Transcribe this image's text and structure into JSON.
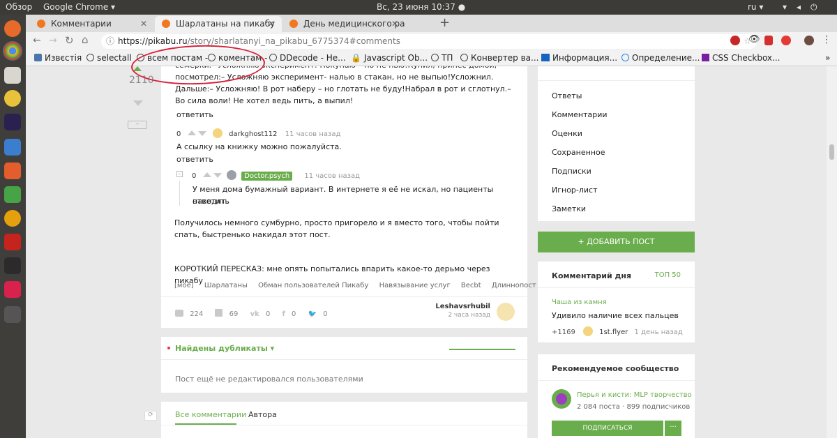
{
  "os": {
    "overview": "Обзор",
    "app": "Google Chrome ▾",
    "clock": "Вс, 23 июня  10:37 ●",
    "lang": "ru ▾"
  },
  "tabs": [
    {
      "label": "Комментарии"
    },
    {
      "label": "Шарлатаны на пикабу"
    },
    {
      "label": "День медицинского раб"
    }
  ],
  "address": {
    "prefix": "https://pikabu.ru",
    "path": "/story/sharlatanyi_na_pikabu_6775374#comments"
  },
  "bookmarks": [
    "Извєстія",
    "selectall",
    "всем постам -",
    "коментам -",
    "DDecode - He...",
    "Javascript Ob...",
    "ТП",
    "Конвертер ва...",
    "Информация...",
    "Определение...",
    "CSS Checkbox..."
  ],
  "post": {
    "rating": "2110",
    "top_text": "семерки.– Усложняю эксперимент! Покупаю – но не пью!Купил, принес домой, посмотрел:– Усложняю эксперимент- налью в стакан, но не выпью!Усложнил. Дальше:– Усложняю! В рот наберу – но глотать не буду!Набрал в рот и сглотнул.– Во сила воли! Не хотел ведь пить, а выпил!",
    "reply": "ответить",
    "comments": [
      {
        "score": "0",
        "user": "darkghost112",
        "time": "11 часов назад",
        "text": "А ссылку на книжку можно пожалуйста."
      },
      {
        "score": "0",
        "user": "Doctor.psych",
        "time": "11 часов назад",
        "text": "У меня дома бумажный вариант. В интернете я её не искал, но пациенты находят."
      }
    ],
    "body1": "Получилось немного сумбурно, просто пригорело и я вместо того, чтобы пойти спать, быстренько накидал этот пост.",
    "body2": "КОРОТКИЙ ПЕРЕСКАЗ: мне опять попытались впарить какое-то дерьмо через пикабу",
    "tags": [
      "[моё]",
      "Шарлатаны",
      "Обман пользователей Пикабу",
      "Навязывание услуг",
      "Becbt",
      "Длиннопост"
    ],
    "stats": {
      "comments": "224",
      "saves": "69",
      "vk": "0",
      "fb": "0",
      "tw": "0"
    },
    "author": "Leshavsrhubil",
    "author_time": "2 часа назад"
  },
  "dupes": {
    "title": "Найдены дубликаты ▾",
    "note": "Пост ещё не редактировался пользователями"
  },
  "comment_tabs": [
    "Все комментарии",
    "Автора"
  ],
  "side_menu": [
    "Ответы",
    "Комментарии",
    "Оценки",
    "Сохраненное",
    "Подписки",
    "Игнор-лист",
    "Заметки"
  ],
  "add_post": "+  ДОБАВИТЬ ПОСТ",
  "cotd": {
    "title": "Комментарий дня",
    "top": "ТОП 50",
    "source": "Чаша из камня",
    "text": "Удивило наличие всех пальцев",
    "score": "+1169",
    "user": "1st.flyer",
    "time": "1 день назад"
  },
  "community": {
    "title": "Рекомендуемое сообщество",
    "name": "Перья и кисти: MLP творчество",
    "stats": "2 084 поста  ·  899 подписчиков",
    "subscribe": "ПОДПИСАТЬСЯ",
    "more": "···"
  },
  "colors": {
    "accent": "#6aad4c",
    "annotation": "#d8203a"
  }
}
